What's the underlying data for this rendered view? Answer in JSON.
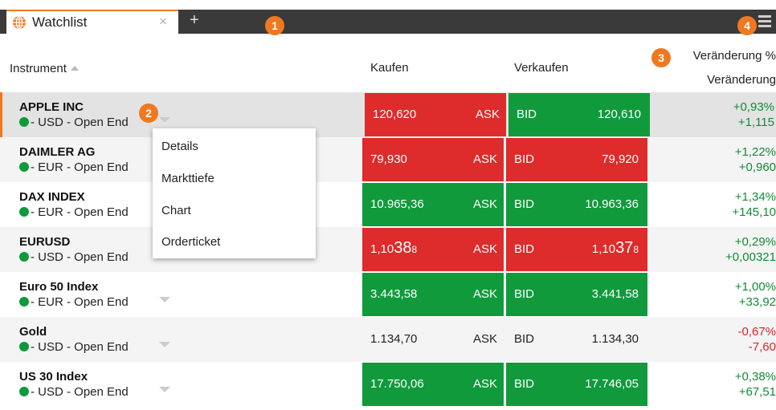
{
  "tab": {
    "title": "Watchlist",
    "close": "×",
    "add": "+"
  },
  "callouts": [
    "1",
    "2",
    "3",
    "4"
  ],
  "header": {
    "instrument": "Instrument",
    "buy": "Kaufen",
    "sell": "Verkaufen",
    "change_pct": "Veränderung %",
    "change": "Veränderung"
  },
  "rows": [
    {
      "name": "APPLE INC",
      "meta": "- USD - Open End",
      "buy": "120,620",
      "ask": "ASK",
      "bid": "BID",
      "sell": "120,610",
      "pct": "+0,93%",
      "abs": "+1,115",
      "color": "red-green"
    },
    {
      "name": "DAIMLER AG",
      "meta": "- EUR - Open End",
      "buy": "79,930",
      "ask": "ASK",
      "bid": "BID",
      "sell": "79,920",
      "pct": "+1,22%",
      "abs": "+0,960"
    },
    {
      "name": "DAX INDEX",
      "meta": "- EUR - Open End",
      "buy": "10.965,36",
      "ask": "ASK",
      "bid": "BID",
      "sell": "10.963,36",
      "pct": "+1,34%",
      "abs": "+145,10"
    },
    {
      "name": "EURUSD",
      "meta": "- USD - Open End",
      "buy_a": "1,10",
      "buy_b": "38",
      "buy_c": "8",
      "ask": "ASK",
      "bid": "BID",
      "sell_a": "1,10",
      "sell_b": "37",
      "sell_c": "8",
      "pct": "+0,29%",
      "abs": "+0,00321"
    },
    {
      "name": "Euro 50 Index",
      "meta": "- EUR - Open End",
      "buy": "3.443,58",
      "ask": "ASK",
      "bid": "BID",
      "sell": "3.441,58",
      "pct": "+1,00%",
      "abs": "+33,92"
    },
    {
      "name": "Gold",
      "meta": "- USD - Open End",
      "buy": "1.134,70",
      "ask": "ASK",
      "bid": "BID",
      "sell": "1.134,30",
      "pct": "-0,67%",
      "abs": "-7,60"
    },
    {
      "name": "US 30 Index",
      "meta": "- USD - Open End",
      "buy": "17.750,06",
      "ask": "ASK",
      "bid": "BID",
      "sell": "17.746,05",
      "pct": "+0,38%",
      "abs": "+67,51"
    }
  ],
  "dropdown": [
    "Details",
    "Markttiefe",
    "Chart",
    "Orderticket"
  ],
  "colors": {
    "accent": "#f07820",
    "ask_red": "#de2b2b",
    "bid_green": "#109a3c",
    "positive": "#128a36",
    "negative": "#d8262b"
  },
  "icons": [
    "globe-icon",
    "close-icon",
    "add-tab-icon",
    "menu-icon",
    "sort-ascending-icon",
    "chevron-down-icon",
    "status-dot-icon"
  ]
}
